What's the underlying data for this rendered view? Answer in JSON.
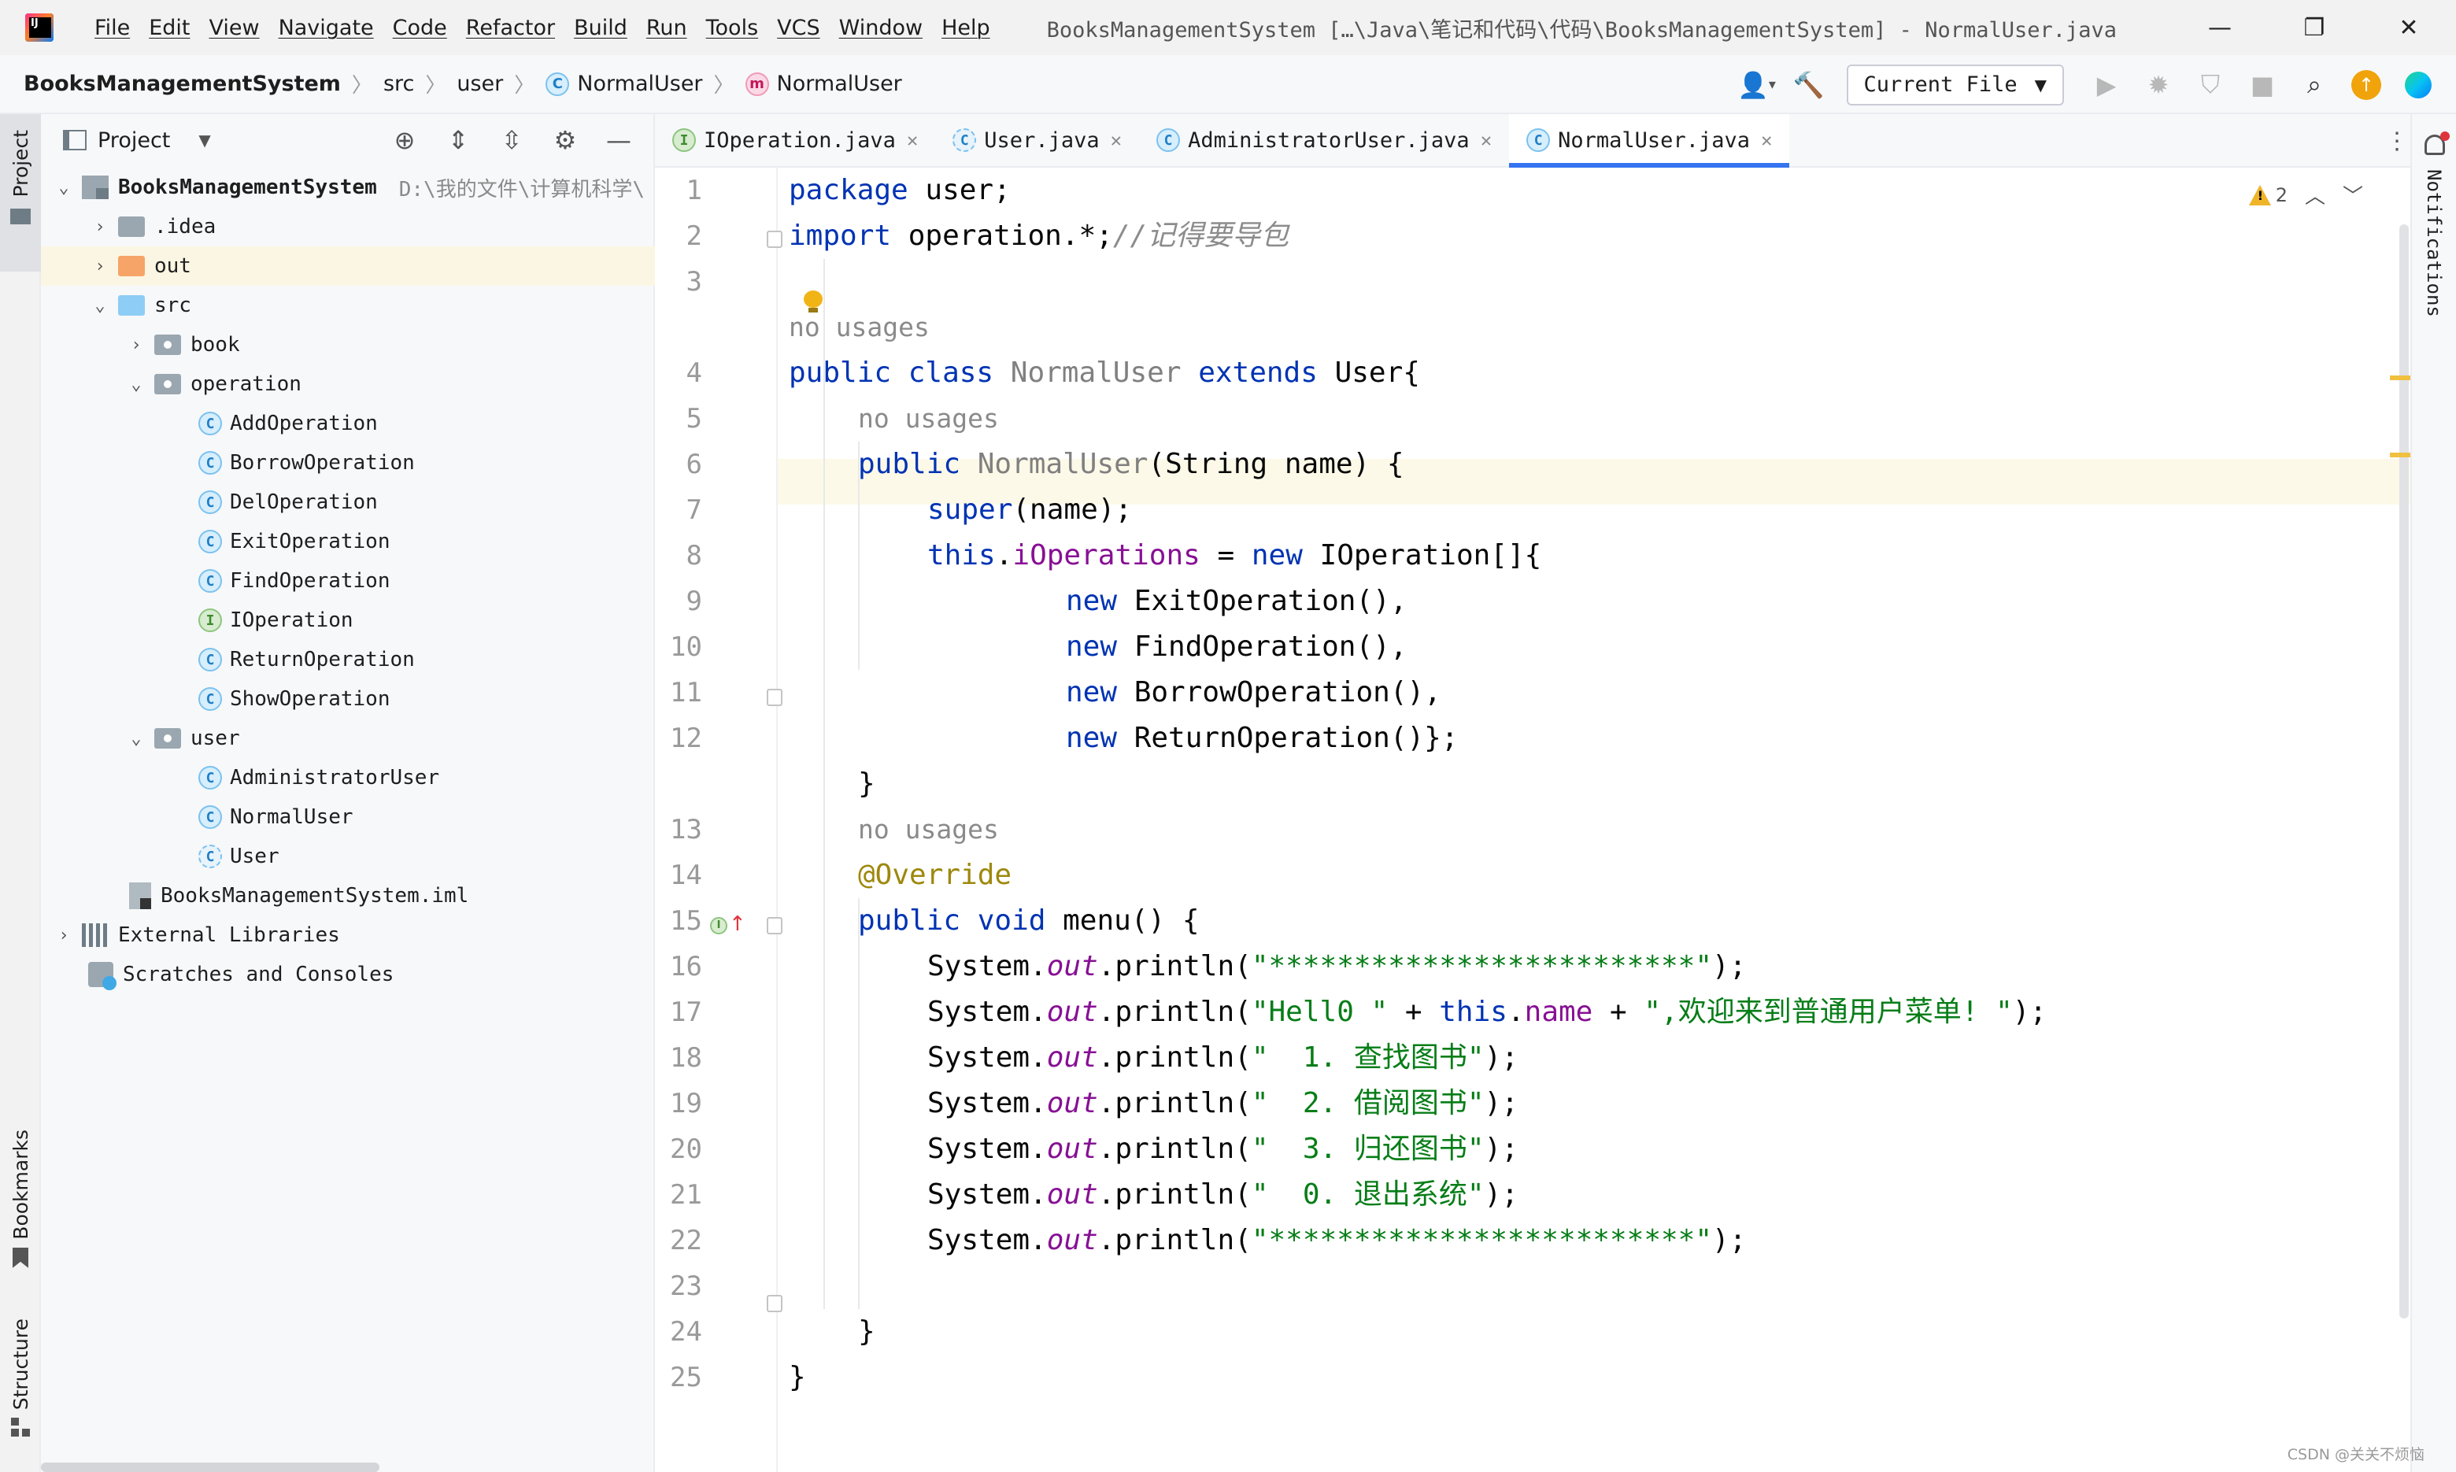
{
  "titlebar": {
    "menu": [
      "File",
      "Edit",
      "View",
      "Navigate",
      "Code",
      "Refactor",
      "Build",
      "Run",
      "Tools",
      "VCS",
      "Window",
      "Help"
    ],
    "window_title": "BooksManagementSystem […\\Java\\笔记和代码\\代码\\BooksManagementSystem] - NormalUser.java",
    "controls": [
      "—",
      "❐",
      "✕"
    ]
  },
  "navbar": {
    "project": "BooksManagementSystem",
    "src": "src",
    "pkg": "user",
    "cls": "NormalUser",
    "member": "NormalUser",
    "run_config": "Current File"
  },
  "left_stripe": {
    "project": "Project",
    "bookmarks": "Bookmarks",
    "structure": "Structure"
  },
  "project_panel": {
    "title": "Project",
    "tree": [
      {
        "label": "BooksManagementSystem",
        "hint": "D:\\我的文件\\计算机科学\\"
      },
      {
        "label": ".idea"
      },
      {
        "label": "out"
      },
      {
        "label": "src"
      },
      {
        "label": "book"
      },
      {
        "label": "operation"
      },
      {
        "label": "AddOperation"
      },
      {
        "label": "BorrowOperation"
      },
      {
        "label": "DelOperation"
      },
      {
        "label": "ExitOperation"
      },
      {
        "label": "FindOperation"
      },
      {
        "label": "IOperation"
      },
      {
        "label": "ReturnOperation"
      },
      {
        "label": "ShowOperation"
      },
      {
        "label": "user"
      },
      {
        "label": "AdministratorUser"
      },
      {
        "label": "NormalUser"
      },
      {
        "label": "User"
      },
      {
        "label": "BooksManagementSystem.iml"
      },
      {
        "label": "External Libraries"
      },
      {
        "label": "Scratches and Consoles"
      }
    ]
  },
  "editor_tabs": [
    "IOperation.java",
    "User.java",
    "AdministratorUser.java",
    "NormalUser.java"
  ],
  "editor": {
    "warning_count": "2",
    "line_numbers": [
      "1",
      "2",
      "3",
      "4",
      "5",
      "6",
      "7",
      "8",
      "9",
      "10",
      "11",
      "12",
      "13",
      "14",
      "15",
      "16",
      "17",
      "18",
      "19",
      "20",
      "21",
      "22",
      "23",
      "24",
      "25"
    ],
    "hint_no_usages": "no usages",
    "code": {
      "l1_kw": "package",
      "l1_rest": " user;",
      "l2_kw": "import",
      "l2_rest": " operation.*;",
      "l2_cmt": "//记得要导包",
      "l4_a": "public class",
      "l4_b": " NormalUser",
      "l4_c": " extends",
      "l4_d": " User{",
      "l5_a": "public",
      "l5_b": " NormalUser",
      "l5_c": "(String name) {",
      "l6_a": "super",
      "l6_b": "(name);",
      "l7_a": "this",
      "l7_b": ".",
      "l7_c": "iOperations",
      "l7_d": " = ",
      "l7_e": "new",
      "l7_f": " IOperation[]{",
      "l8_a": "new",
      "l8_b": " ExitOperation(),",
      "l9_a": "new",
      "l9_b": " FindOperation(),",
      "l10_a": "new",
      "l10_b": " BorrowOperation(),",
      "l11_a": "new",
      "l11_b": " ReturnOperation()};",
      "l12": "}",
      "l13": "@Override",
      "l14_a": "public void",
      "l14_b": " menu() {",
      "sys": "System.",
      "out": "out",
      "println": ".println(",
      "end": ");",
      "l15_str": "\"*************************\"",
      "l16_str1": "\"Hell0 \"",
      "l16_plus1": " + ",
      "l16_this": "this",
      "l16_dot": ".",
      "l16_name": "name",
      "l16_plus2": " + ",
      "l16_str2": "\",欢迎来到普通用户菜单! \"",
      "l17_str": "\"  1. 查找图书\"",
      "l18_str": "\"  2. 借阅图书\"",
      "l19_str": "\"  3. 归还图书\"",
      "l20_str": "\"  0. 退出系统\"",
      "l21_str": "\"*************************\"",
      "l23": "}",
      "l24": "}"
    }
  },
  "right_stripe": {
    "notifications": "Notifications"
  },
  "watermark": "CSDN @关关不烦恼",
  "colors": {
    "keyword": "#0033b3",
    "string": "#067d17",
    "comment": "#8c8c8c",
    "field": "#871094",
    "annotation": "#9e880d",
    "accent": "#3574f0"
  }
}
